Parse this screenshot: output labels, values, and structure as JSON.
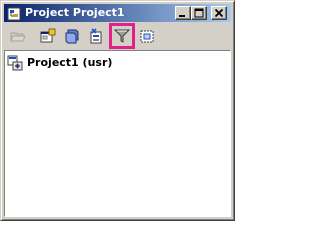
{
  "window": {
    "title": "Project Project1",
    "buttons": [
      "minimize",
      "maximize",
      "close"
    ]
  },
  "toolbar": {
    "items": [
      {
        "icon": "open-folder-icon",
        "state": "disabled"
      },
      {
        "icon": "view-object-icon",
        "state": "enabled"
      },
      {
        "icon": "view-code-icon",
        "state": "enabled"
      },
      {
        "icon": "properties-icon",
        "state": "enabled"
      },
      {
        "icon": "filter-icon",
        "state": "enabled",
        "highlighted": true
      },
      {
        "icon": "toggle-folders-icon",
        "state": "enabled"
      }
    ]
  },
  "tree": {
    "nodes": [
      {
        "label": "Project1 (usr)",
        "icon": "project-icon"
      }
    ]
  },
  "colors": {
    "title_gradient_start": "#0a246a",
    "title_gradient_end": "#a6caf0",
    "window_face": "#d4d0c8",
    "highlight_box": "#e0218a"
  }
}
